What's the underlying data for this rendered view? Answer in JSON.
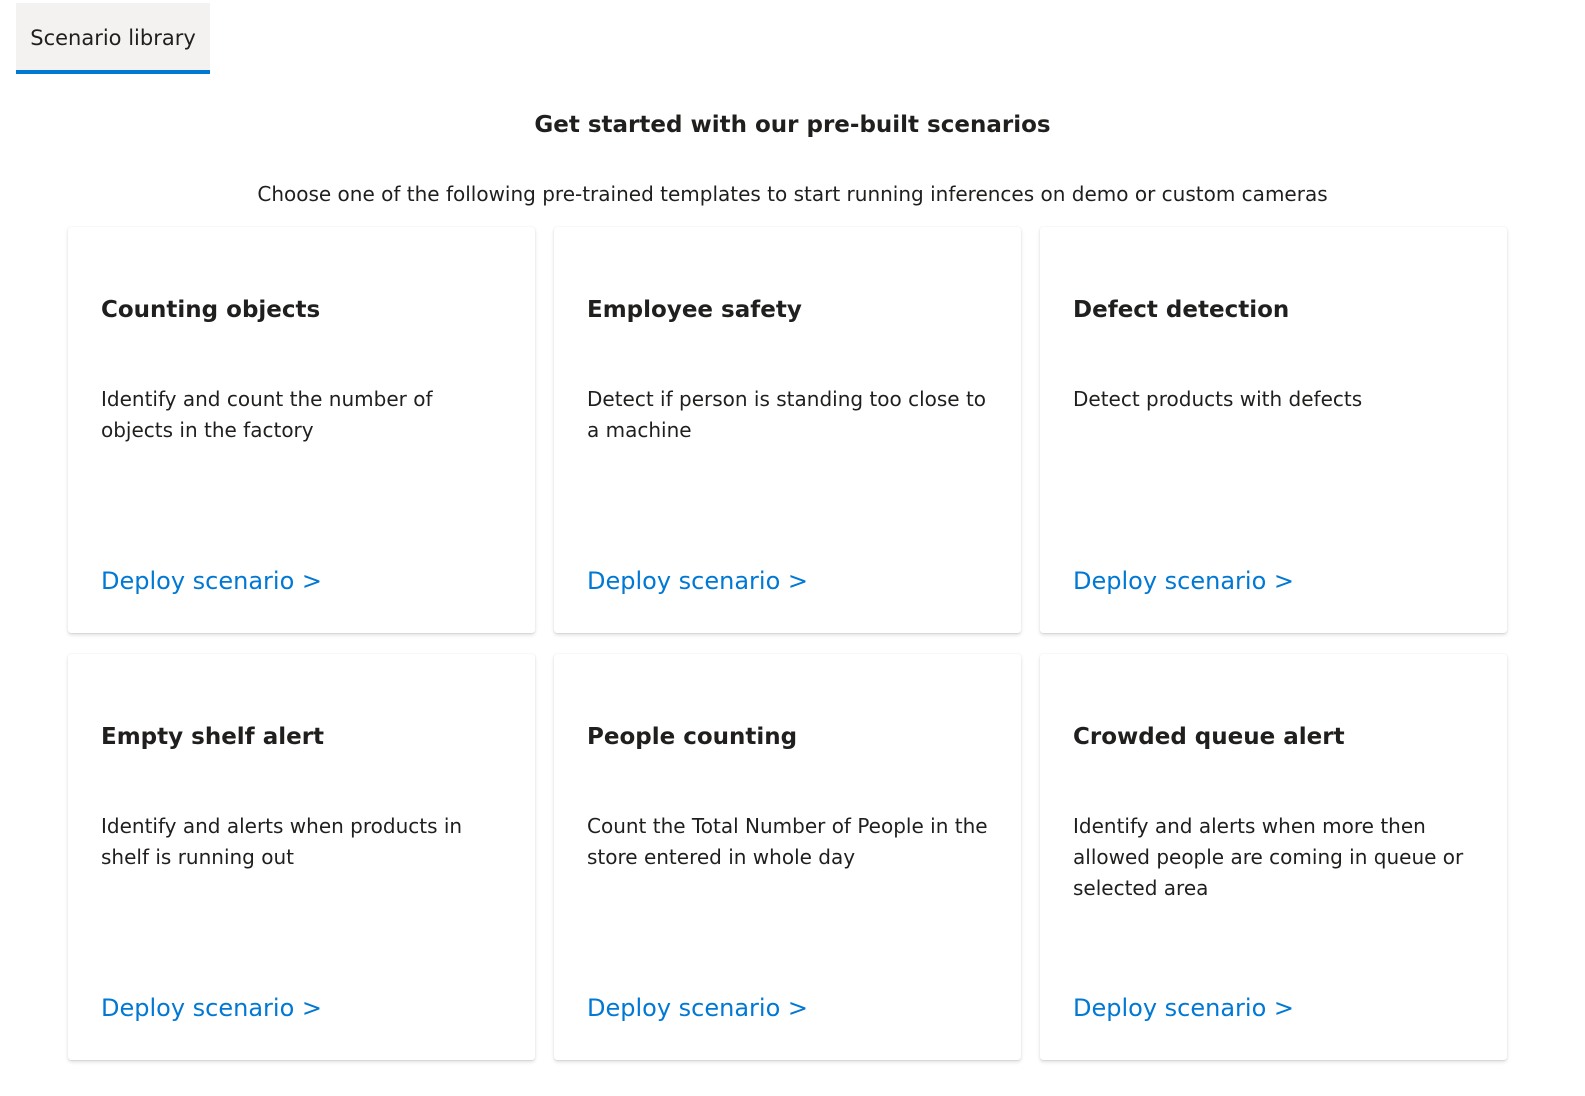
{
  "tab": {
    "label": "Scenario library"
  },
  "header": {
    "title": "Get started with our pre-built scenarios",
    "subtitle": "Choose one of the following pre-trained templates to start running inferences on demo or custom cameras"
  },
  "cards": [
    {
      "title": "Counting objects",
      "description": "Identify and count the number of objects in the factory",
      "link": "Deploy scenario >"
    },
    {
      "title": "Employee safety",
      "description": "Detect if person is standing too close to a machine",
      "link": "Deploy scenario >"
    },
    {
      "title": "Defect detection",
      "description": "Detect products with defects",
      "link": "Deploy scenario >"
    },
    {
      "title": "Empty shelf alert",
      "description": "Identify and alerts when products in shelf is running out",
      "link": "Deploy scenario >"
    },
    {
      "title": "People counting",
      "description": "Count the Total Number of People in the store entered in whole day",
      "link": "Deploy scenario >"
    },
    {
      "title": "Crowded queue alert",
      "description": "Identify and alerts when more then allowed people are coming in queue or selected area",
      "link": "Deploy scenario >"
    }
  ]
}
